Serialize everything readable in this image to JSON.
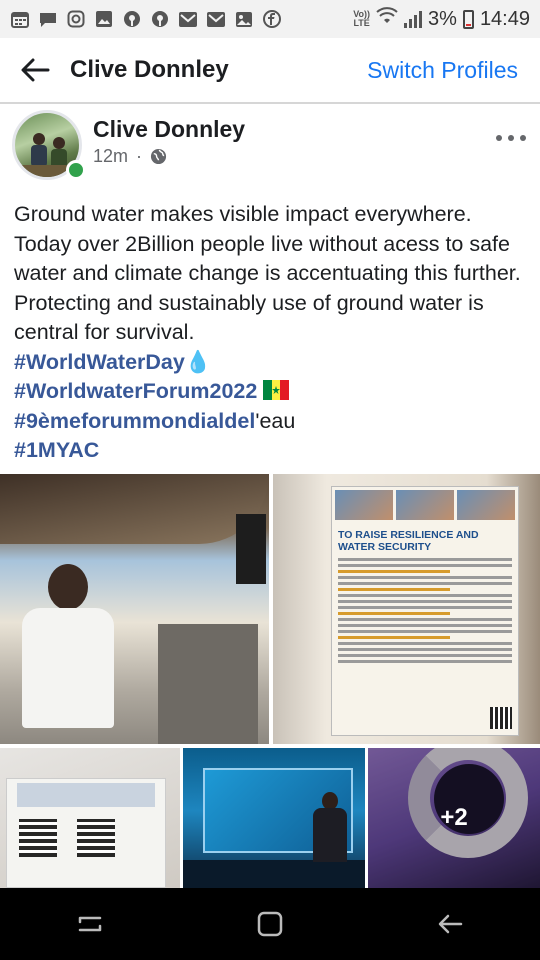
{
  "status_bar": {
    "icons": [
      "calendar-icon",
      "message-icon",
      "instagram-icon",
      "gallery-icon",
      "pinterest-icon",
      "pinterest-icon",
      "mail-icon",
      "mail-icon",
      "image-icon",
      "facebook-icon"
    ],
    "volte_top": "Vo))",
    "volte_bottom": "LTE",
    "battery": "3%",
    "time": "14:49"
  },
  "header": {
    "back_icon": "back-arrow-icon",
    "title": "Clive Donnley",
    "switch_label": "Switch Profiles",
    "accent_color": "#1877f2"
  },
  "post": {
    "author": "Clive Donnley",
    "time": "12m",
    "separator": "·",
    "privacy_icon": "globe-icon",
    "more_icon": "more-horizontal-icon",
    "body": "Ground water makes visible impact everywhere. Today over 2Billion people live without acess to safe water and climate change is accentuating this further. Protecting and sustainably use of ground water is central for survival.",
    "hashtags": {
      "tag1": "#WorldWaterDay",
      "tag1_emoji": "💧",
      "tag2": "#WorldwaterForum2022",
      "tag2_flag_icon": "senegal-flag-icon",
      "tag3": "#9èmeforummondialdel",
      "tag3_suffix": "'eau",
      "tag4": "#1MYAC"
    },
    "hashtag_color": "#385898"
  },
  "photos": {
    "poster_title": "TO RAISE RESILIENCE AND WATER SECURITY",
    "more_count": "+2"
  },
  "nav_bar": {
    "recent_icon": "recent-apps-icon",
    "home_icon": "home-icon",
    "back_icon": "back-icon"
  }
}
